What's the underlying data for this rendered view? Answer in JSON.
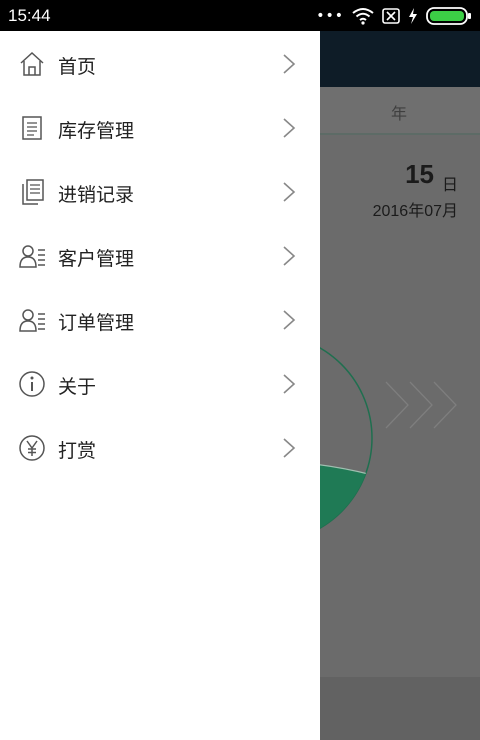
{
  "status_bar": {
    "time": "15:44",
    "icons": [
      "more-dots-icon",
      "wifi-icon",
      "no-sim-icon",
      "charging-icon",
      "battery-icon"
    ]
  },
  "background": {
    "tab_year": "年",
    "day_number": "15",
    "day_unit": "日",
    "year_month": "2016年07月"
  },
  "drawer": {
    "items": [
      {
        "label": "首页",
        "icon": "home-icon"
      },
      {
        "label": "库存管理",
        "icon": "document-icon"
      },
      {
        "label": "进销记录",
        "icon": "copy-documents-icon"
      },
      {
        "label": "客户管理",
        "icon": "contact-list-icon"
      },
      {
        "label": "订单管理",
        "icon": "contact-list-icon"
      },
      {
        "label": "关于",
        "icon": "info-icon"
      },
      {
        "label": "打赏",
        "icon": "yen-coin-icon"
      }
    ]
  },
  "colors": {
    "accent_green": "#1f7a55",
    "overlay": "#6b6b6b",
    "header": "#0e1c27",
    "icon": "#555555"
  }
}
